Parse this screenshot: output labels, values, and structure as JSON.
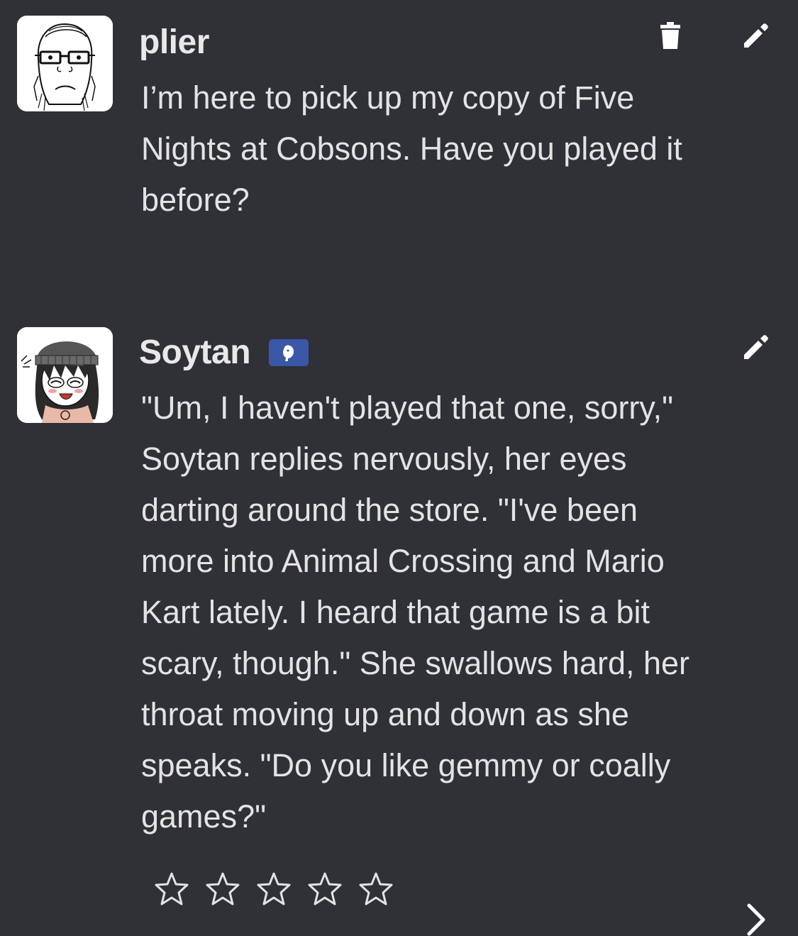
{
  "messages": [
    {
      "author": "plier",
      "text": "I’m here to pick up my copy of Five\nNights at Cobsons. Have you played it\nbefore?",
      "avatar": "soyjak-glasses-avatar",
      "actions": [
        "trash-icon",
        "pencil-icon"
      ]
    },
    {
      "author": "Soytan",
      "badge": "bot-badge",
      "text": "\"Um, I haven't played that one, sorry,\"\nSoytan replies nervously, her eyes\ndarting around the store. \"I've been\nmore into Animal Crossing and Mario\nKart lately. I heard that game is a bit\nscary, though.\" She swallows hard, her\nthroat moving up and down as she\nspeaks. \"Do you like gemmy or coally\ngames?\"",
      "avatar": "anime-girl-beanie-avatar",
      "actions": [
        "pencil-icon"
      ]
    }
  ],
  "rating": {
    "max_stars": 5,
    "selected": 0
  },
  "colors": {
    "background": "#2f3137",
    "text": "#e3e3e3",
    "badge": "#3a57a8"
  },
  "icons": {
    "delete": "trash-icon",
    "edit": "pencil-icon",
    "star": "star-outline-icon",
    "next": "chevron-right-icon"
  }
}
